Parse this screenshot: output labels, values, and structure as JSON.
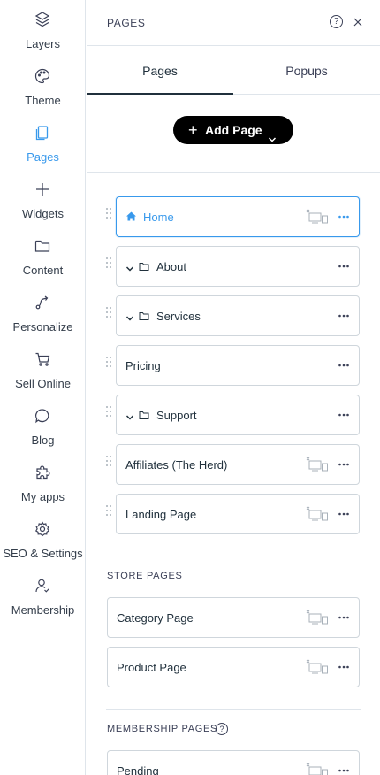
{
  "rail": {
    "items": [
      {
        "label": "Layers",
        "icon": "layers-icon"
      },
      {
        "label": "Theme",
        "icon": "palette-icon"
      },
      {
        "label": "Pages",
        "icon": "pages-icon",
        "active": true
      },
      {
        "label": "Widgets",
        "icon": "plus-icon"
      },
      {
        "label": "Content",
        "icon": "folder-icon"
      },
      {
        "label": "Personalize",
        "icon": "personalize-icon"
      },
      {
        "label": "Sell Online",
        "icon": "cart-icon"
      },
      {
        "label": "Blog",
        "icon": "chat-bubble-icon"
      },
      {
        "label": "My apps",
        "icon": "puzzle-icon"
      },
      {
        "label": "SEO & Settings",
        "icon": "gear-icon"
      },
      {
        "label": "Membership",
        "icon": "member-icon"
      }
    ]
  },
  "panel": {
    "title": "PAGES",
    "help": "?",
    "tabs": [
      {
        "label": "Pages",
        "active": true
      },
      {
        "label": "Popups",
        "active": false
      }
    ],
    "add_page_label": "Add Page"
  },
  "pages": [
    {
      "name": "Home",
      "home": true,
      "selected": true,
      "folder": false,
      "hidden": true,
      "draggable": true
    },
    {
      "name": "About",
      "folder": true,
      "hidden": false,
      "draggable": true
    },
    {
      "name": "Services",
      "folder": true,
      "hidden": false,
      "draggable": true
    },
    {
      "name": "Pricing",
      "folder": false,
      "hidden": false,
      "draggable": true
    },
    {
      "name": "Support",
      "folder": true,
      "hidden": false,
      "draggable": true
    },
    {
      "name": "Affiliates (The Herd)",
      "folder": false,
      "hidden": true,
      "draggable": true
    },
    {
      "name": "Landing Page",
      "folder": false,
      "hidden": true,
      "draggable": true
    }
  ],
  "store_section": {
    "title": "STORE PAGES",
    "pages": [
      {
        "name": "Category Page",
        "hidden": true
      },
      {
        "name": "Product Page",
        "hidden": true
      }
    ]
  },
  "membership_section": {
    "title": "MEMBERSHIP PAGES",
    "help": "?",
    "pages": [
      {
        "name": "Pending",
        "hidden": true
      }
    ]
  },
  "colors": {
    "accent": "#3899ec",
    "text": "#20303c",
    "border": "#cfd6dc",
    "button_bg": "#000000"
  }
}
